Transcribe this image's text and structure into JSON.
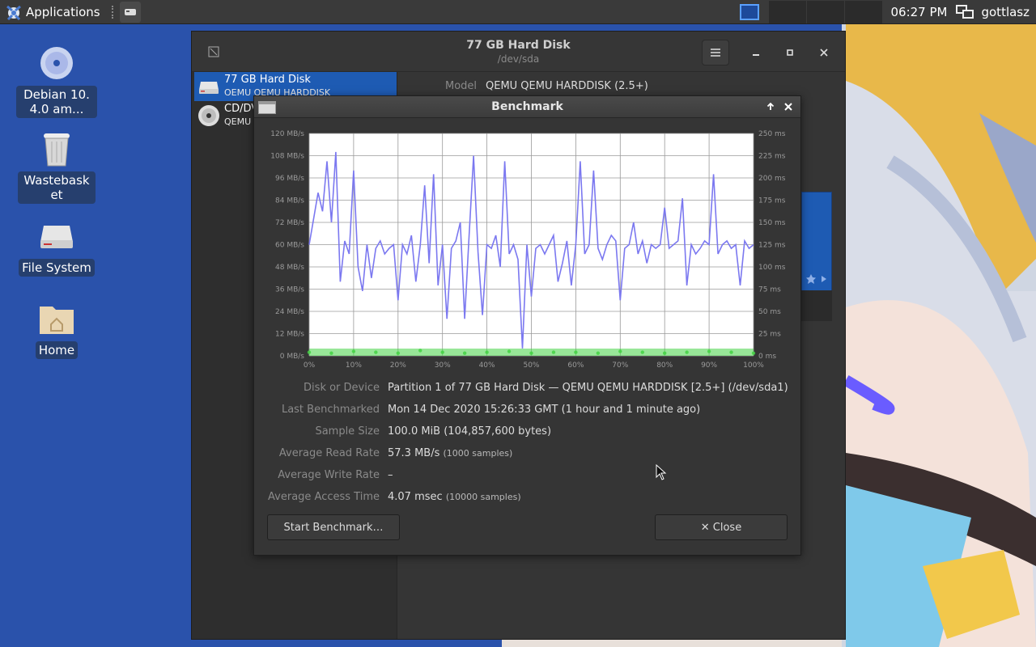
{
  "panel": {
    "applications_label": "Applications",
    "clock": "06:27 PM",
    "username": "gottlasz"
  },
  "desktop": {
    "icons": [
      {
        "label": "Debian 10.4.0 am...",
        "icon": "cd-icon"
      },
      {
        "label": "Wastebasket",
        "icon": "trash-icon"
      },
      {
        "label": "File System",
        "icon": "drive-icon"
      },
      {
        "label": "Home",
        "icon": "home-folder-icon"
      }
    ]
  },
  "disks_window": {
    "title": "77 GB Hard Disk",
    "subtitle": "/dev/sda",
    "drives": [
      {
        "name": "77 GB Hard Disk",
        "sub": "QEMU QEMU HARDDISK",
        "icon": "hard-disk-icon",
        "selected": true
      },
      {
        "name": "CD/DVD Drive",
        "sub": "QEMU QEMU DVD-ROM",
        "icon": "optical-drive-icon",
        "selected": false
      }
    ],
    "model_label": "Model",
    "model_value": "QEMU QEMU HARDDISK (2.5+)"
  },
  "benchmark": {
    "title": "Benchmark",
    "info": [
      {
        "key": "Disk or Device",
        "value": "Partition 1 of 77 GB Hard Disk — QEMU QEMU HARDDISK [2.5+] (/dev/sda1)",
        "note": ""
      },
      {
        "key": "Last Benchmarked",
        "value": "Mon 14 Dec 2020 15:26:33 GMT (1 hour and 1 minute ago)",
        "note": ""
      },
      {
        "key": "Sample Size",
        "value": "100.0 MiB (104,857,600 bytes)",
        "note": ""
      },
      {
        "key": "Average Read Rate",
        "value": "57.3 MB/s",
        "note": "(1000 samples)"
      },
      {
        "key": "Average Write Rate",
        "value": "–",
        "note": ""
      },
      {
        "key": "Average Access Time",
        "value": "4.07 msec",
        "note": "(10000 samples)"
      }
    ],
    "start_button": "Start Benchmark…",
    "close_button": "✕ Close"
  },
  "chart_data": {
    "type": "line",
    "title": "",
    "x_ticks": [
      "0%",
      "10%",
      "20%",
      "30%",
      "40%",
      "50%",
      "60%",
      "70%",
      "80%",
      "90%",
      "100%"
    ],
    "y_left_ticks": [
      "0 MB/s",
      "12 MB/s",
      "24 MB/s",
      "36 MB/s",
      "48 MB/s",
      "60 MB/s",
      "72 MB/s",
      "84 MB/s",
      "96 MB/s",
      "108 MB/s",
      "120 MB/s"
    ],
    "y_right_ticks": [
      "0 ms",
      "25 ms",
      "50 ms",
      "75 ms",
      "100 ms",
      "125 ms",
      "150 ms",
      "175 ms",
      "200 ms",
      "225 ms",
      "250 ms"
    ],
    "ylim_left": [
      0,
      120
    ],
    "ylim_right": [
      0,
      250
    ],
    "grid": true,
    "series": [
      {
        "color": "#7b78f0",
        "x": [
          0,
          2,
          3,
          4,
          5,
          6,
          7,
          8,
          9,
          10,
          11,
          12,
          13,
          14,
          15,
          16,
          17,
          18,
          19,
          20,
          21,
          22,
          23,
          24,
          25,
          26,
          27,
          28,
          29,
          30,
          31,
          32,
          33,
          34,
          35,
          36,
          37,
          38,
          39,
          40,
          41,
          42,
          43,
          44,
          45,
          46,
          47,
          48,
          49,
          50,
          51,
          52,
          53,
          54,
          55,
          56,
          57,
          58,
          59,
          60,
          61,
          62,
          63,
          64,
          65,
          66,
          67,
          68,
          69,
          70,
          71,
          72,
          73,
          74,
          75,
          76,
          77,
          78,
          79,
          80,
          81,
          82,
          83,
          84,
          85,
          86,
          87,
          88,
          89,
          90,
          91,
          92,
          93,
          94,
          95,
          96,
          97,
          98,
          99,
          100
        ],
        "values": [
          60,
          88,
          78,
          105,
          72,
          110,
          40,
          62,
          55,
          100,
          48,
          35,
          60,
          42,
          58,
          62,
          55,
          58,
          60,
          30,
          60,
          55,
          65,
          40,
          60,
          92,
          50,
          98,
          38,
          60,
          20,
          58,
          62,
          72,
          20,
          65,
          108,
          56,
          22,
          60,
          58,
          65,
          48,
          105,
          55,
          60,
          52,
          4,
          60,
          32,
          58,
          60,
          55,
          60,
          65,
          40,
          50,
          62,
          38,
          60,
          105,
          55,
          60,
          100,
          58,
          52,
          60,
          65,
          62,
          30,
          58,
          60,
          72,
          55,
          62,
          50,
          60,
          58,
          60,
          80,
          58,
          60,
          62,
          85,
          38,
          60,
          55,
          58,
          62,
          60,
          98,
          55,
          60,
          62,
          58,
          60,
          38,
          62,
          58,
          60
        ]
      },
      {
        "color": "#44d244",
        "x": [
          0,
          5,
          10,
          15,
          20,
          25,
          30,
          35,
          40,
          45,
          50,
          55,
          60,
          65,
          70,
          75,
          80,
          85,
          90,
          95,
          100
        ],
        "values_ms": [
          4,
          3,
          5,
          4,
          3,
          6,
          4,
          3,
          4,
          5,
          3,
          4,
          4,
          3,
          5,
          4,
          3,
          4,
          5,
          4,
          3
        ]
      }
    ]
  }
}
